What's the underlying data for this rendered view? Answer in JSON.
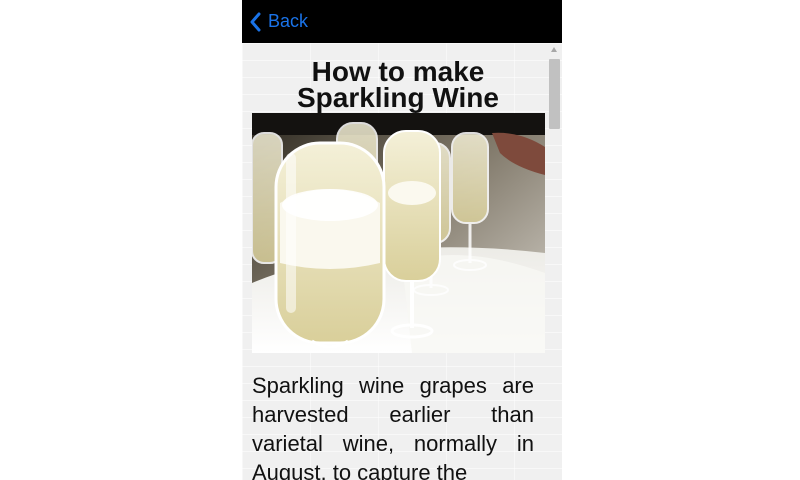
{
  "header": {
    "back_label": "Back",
    "back_icon": "chevron-left-icon",
    "accent_color": "#1a73e8",
    "bar_color": "#000000"
  },
  "article": {
    "title": "How to make Sparkling Wine",
    "image_subject": "glasses of sparkling wine being poured on a tray",
    "body_text": "Sparkling wine grapes are harvested earlier than varietal wine, normally in August, to capture the"
  }
}
